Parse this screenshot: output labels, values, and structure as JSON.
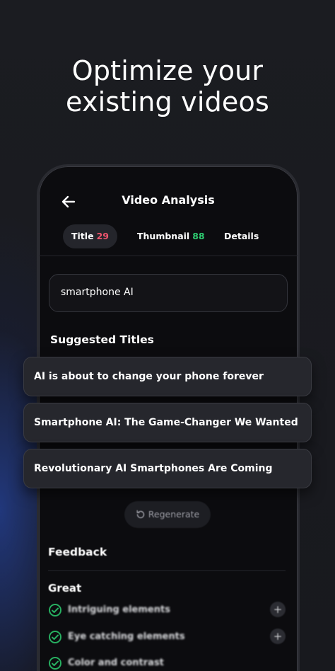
{
  "headline": {
    "line1": "Optimize your",
    "line2": "existing videos"
  },
  "screen": {
    "title": "Video Analysis",
    "tabs": [
      {
        "label": "Title",
        "score": "29"
      },
      {
        "label": "Thumbnail",
        "score": "88"
      },
      {
        "label": "Details"
      }
    ],
    "search_value": "smartphone AI",
    "suggested_heading": "Suggested Titles",
    "suggestions": [
      "AI is about to change your phone forever",
      "Smartphone AI: The Game-Changer We Wanted",
      "Revolutionary AI Smartphones Are Coming"
    ],
    "regenerate_label": "Regenerate",
    "feedback_heading": "Feedback",
    "great_heading": "Great",
    "feedback_items": [
      "Intriguing elements",
      "Eye catching elements",
      "Color and contrast"
    ]
  },
  "colors": {
    "accent_red": "#f0556e",
    "accent_green": "#2ecc71",
    "check_green": "#27ae60"
  },
  "icons": [
    "back-arrow-icon",
    "regenerate-icon",
    "check-circle-icon",
    "plus-icon"
  ]
}
